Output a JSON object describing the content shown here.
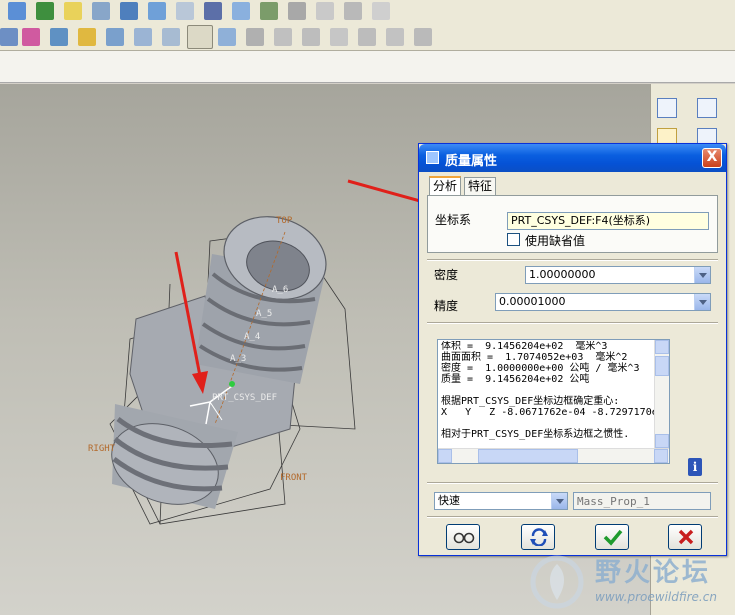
{
  "dialog": {
    "title": "质量属性",
    "close_label": "X",
    "tabs": [
      {
        "label": "分析"
      },
      {
        "label": "特征"
      }
    ],
    "coord_system_label": "坐标系",
    "coord_system_value": "PRT_CSYS_DEF:F4(坐标系)",
    "use_default_label": "使用缺省值",
    "use_default_checked": false,
    "density_label": "密度",
    "density_value": "1.00000000",
    "precision_label": "精度",
    "precision_value": "0.00001000",
    "results_lines": [
      "体积 =  9.1456204e+02  毫米^3",
      "曲面面积 =  1.7074052e+03  毫米^2",
      "密度 =  1.0000000e+00 公吨 / 毫米^3",
      "质量 =  9.1456204e+02 公吨",
      "",
      "根据PRT_CSYS_DEF坐标边框确定重心:",
      "X   Y   Z -8.0671762e-04 -8.7297170e",
      "",
      "相对于PRT_CSYS_DEF坐标系边框之惯性."
    ],
    "mode_value": "快速",
    "analysis_name_placeholder": "Mass_Prop_1",
    "buttons": {
      "glasses": "glasses-icon",
      "repeat": "repeat-icon",
      "ok": "check-icon",
      "cancel": "x-icon"
    }
  },
  "model_labels": {
    "top": "TOP",
    "right": "RIGHT",
    "front": "FRONT",
    "csys": "PRT_CSYS_DEF",
    "axes": [
      "A_6",
      "A_5",
      "A_4",
      "A_3"
    ]
  },
  "watermark": {
    "title": "野火论坛",
    "url": "www.proewildfire.cn"
  },
  "colors": {
    "titlebar": "#0a5fe0",
    "arrow": "#e0201a",
    "datum_label": "#b36a2c",
    "ok_green": "#1f9b2e",
    "cancel_red": "#c81e1e"
  }
}
